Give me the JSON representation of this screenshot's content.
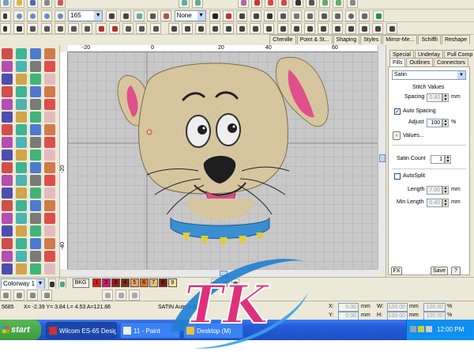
{
  "toolbar1": {
    "zoom_value": "165",
    "none_select": "None"
  },
  "object_tabs": [
    "Chenille",
    "Point & St...",
    "Shaping",
    "Styles",
    "Mirror-Me...",
    "Schiffli",
    "Reshape"
  ],
  "ruler": {
    "top_marks": [
      "-20",
      "0",
      "20",
      "40",
      "60"
    ],
    "left_marks": [
      "-20",
      "-40"
    ]
  },
  "right_panel": {
    "tabs_row1": [
      "Special",
      "Underlay",
      "Pull Comp"
    ],
    "tabs_row2": [
      "Fills",
      "Outlines",
      "Connectors"
    ],
    "fill_type": "Satin",
    "stitch_values_label": "Stitch Values",
    "spacing_label": "Spacing",
    "spacing_value": "0.40",
    "unit_mm": "mm",
    "auto_spacing_label": "Auto Spacing",
    "adjust_label": "Adjust",
    "adjust_value": "100",
    "percent": "%",
    "values_button": "Values...",
    "satin_count_label": "Satin Count",
    "satin_count_value": "1",
    "autosplit_label": "AutoSplit",
    "length_label": "Length",
    "length_value": "7.00",
    "min_length_label": "Min Length",
    "min_length_value": "0.40",
    "fx_button": "FX",
    "save_button": "Save",
    "help_button": "?"
  },
  "colorway": {
    "select_value": "Colorway 1",
    "bkg_label": "BKG",
    "swatches": [
      {
        "label": "1",
        "color": "#e01818"
      },
      {
        "label": "2",
        "color": "#d01870"
      },
      {
        "label": "3",
        "color": "#a01818"
      },
      {
        "label": "4",
        "color": "#7a3010"
      },
      {
        "label": "5",
        "color": "#f0a060"
      },
      {
        "label": "6",
        "color": "#e07020"
      },
      {
        "label": "7",
        "color": "#e8c070"
      },
      {
        "label": "8",
        "color": "#7a2010"
      },
      {
        "label": "9",
        "color": "#f0e0a0"
      }
    ]
  },
  "status": {
    "stitch_count": "5685",
    "coords": "X= -2.39 Y= 3.84 L= 4.53 A=121.86",
    "mode": "SATIN Auto 1.00",
    "x_label": "X:",
    "y_label": "Y:",
    "w_label": "W:",
    "h_label": "H:",
    "x_value": "0.00",
    "y_value": "0.00",
    "w_value": "100.00",
    "h_value": "100.00",
    "mm": "mm",
    "pct": "%"
  },
  "taskbar": {
    "start": "start",
    "items": [
      "Wilcom ES-65 Design...",
      "11 - Paint",
      "Desktop (M)"
    ],
    "clock": "12:00 PM"
  },
  "watermark": "TK",
  "colors": {
    "canvas": "#c8c8c8",
    "grid": "#a7a7a7",
    "taskbar": "#245edb",
    "start": "#3c9a3c",
    "dog_fur": "#d9c9a2",
    "ear_inner": "#e0508a",
    "collar": "#3a8fd0"
  }
}
